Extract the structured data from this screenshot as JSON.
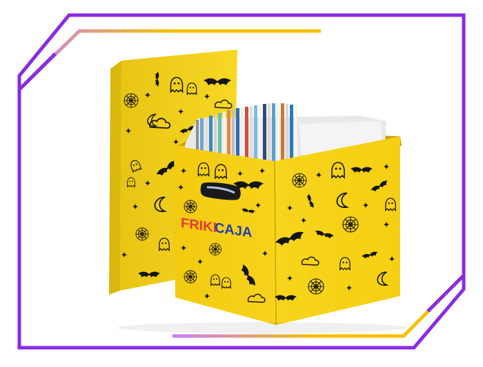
{
  "image": {
    "kind": "product-photo",
    "brand": {
      "part1": "FRIKI",
      "part2": "CAJA"
    },
    "colors": {
      "background": "#ffffff",
      "frame_purple": "#8a2be2",
      "frame_gold": "#f2c200",
      "box_yellow": "#f6d31a",
      "box_shadow": "#d6b10c",
      "print_black": "#151515",
      "brand_red": "#e53935",
      "brand_blue": "#1f3fae"
    },
    "icons": [
      "bat-icon",
      "ghost-icon",
      "spiderweb-icon",
      "star-icon",
      "cloud-icon",
      "moon-icon"
    ]
  }
}
